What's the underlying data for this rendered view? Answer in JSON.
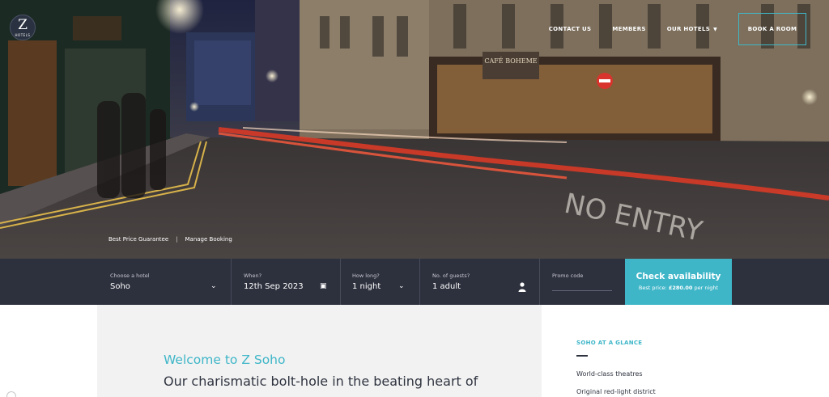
{
  "brand": {
    "logo_letter": "Z",
    "logo_sub": "HOTELS"
  },
  "nav": {
    "contact": "CONTACT US",
    "members": "MEMBERS",
    "hotels": "OUR HOTELS",
    "book": "BOOK A ROOM"
  },
  "hero": {
    "sign_cafe": "CAFÉ BOHEME",
    "road_text": "NO ENTRY",
    "links": [
      "Best Price Guarantee",
      "|",
      "Manage Booking"
    ]
  },
  "booking": {
    "hotel_label": "Choose a hotel",
    "hotel_value": "Soho",
    "date_label": "When?",
    "date_value": "12th Sep 2023",
    "length_label": "How long?",
    "length_value": "1 night",
    "guests_label": "No. of guests?",
    "guests_value": "1 adult",
    "promo_label": "Promo code",
    "promo_value": "",
    "cta_main": "Check availability",
    "cta_sub_prefix": "Best price:",
    "cta_sub_price": "£280.00",
    "cta_sub_suffix": "per night"
  },
  "content": {
    "welcome": "Welcome to Z Soho",
    "tagline": "Our charismatic bolt-hole in the beating heart of"
  },
  "glance": {
    "title": "SOHO AT A GLANCE",
    "items": [
      "World-class theatres",
      "Original red-light district"
    ]
  },
  "colors": {
    "accent": "#3fb6c8",
    "bar": "#2d303d",
    "text_dark": "#2f3440"
  },
  "icons": {
    "dropdown": "chevron-down-icon",
    "calendar": "calendar-icon",
    "guest": "person-icon"
  }
}
